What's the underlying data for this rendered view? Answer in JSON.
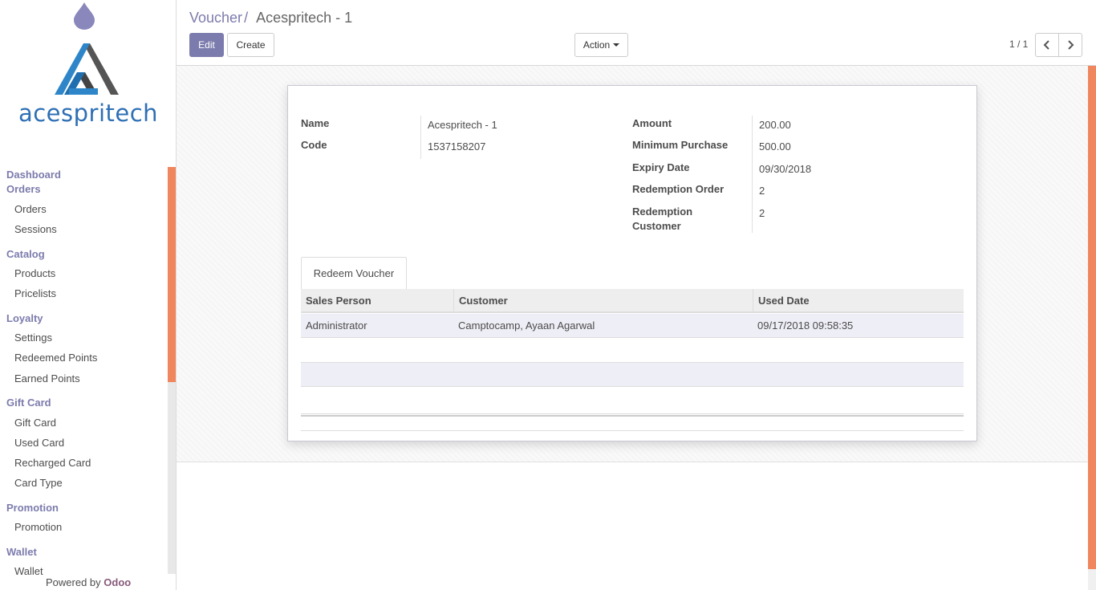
{
  "brand": {
    "logo_text": "acespritech",
    "powered_prefix": "Powered by",
    "powered_brand": "Odoo",
    "colors": {
      "primary": "#7c7bad",
      "accent_blue": "#2e6fb5",
      "scroll_accent": "#f0865e"
    }
  },
  "sidebar": {
    "sections": [
      {
        "title": "Dashboard",
        "items": []
      },
      {
        "title": "Orders",
        "items": [
          "Orders",
          "Sessions"
        ]
      },
      {
        "title": "Catalog",
        "items": [
          "Products",
          "Pricelists"
        ]
      },
      {
        "title": "Loyalty",
        "items": [
          "Settings",
          "Redeemed Points",
          "Earned Points"
        ]
      },
      {
        "title": "Gift Card",
        "items": [
          "Gift Card",
          "Used Card",
          "Recharged Card",
          "Card Type"
        ]
      },
      {
        "title": "Promotion",
        "items": [
          "Promotion"
        ]
      },
      {
        "title": "Wallet",
        "items": [
          "Wallet"
        ]
      }
    ]
  },
  "control": {
    "breadcrumb": {
      "parent": "Voucher",
      "separator": "/",
      "current": "Acespritech - 1"
    },
    "edit_label": "Edit",
    "create_label": "Create",
    "action_label": "Action",
    "pager": "1 / 1",
    "prev_icon": "chevron-left-icon",
    "next_icon": "chevron-right-icon"
  },
  "form": {
    "left": [
      {
        "label": "Name",
        "value": "Acespritech - 1"
      },
      {
        "label": "Code",
        "value": "1537158207"
      }
    ],
    "right": [
      {
        "label": "Amount",
        "value": "200.00"
      },
      {
        "label": "Minimum Purchase",
        "value": "500.00"
      },
      {
        "label": "Expiry Date",
        "value": "09/30/2018"
      },
      {
        "label": "Redemption Order",
        "value": "2"
      },
      {
        "label": "Redemption Customer",
        "value": "2"
      }
    ],
    "tab": "Redeem Voucher",
    "table": {
      "headers": [
        "Sales Person",
        "Customer",
        "Used Date"
      ],
      "rows": [
        [
          "Administrator",
          "Camptocamp, Ayaan Agarwal",
          "09/17/2018 09:58:35"
        ]
      ]
    }
  }
}
